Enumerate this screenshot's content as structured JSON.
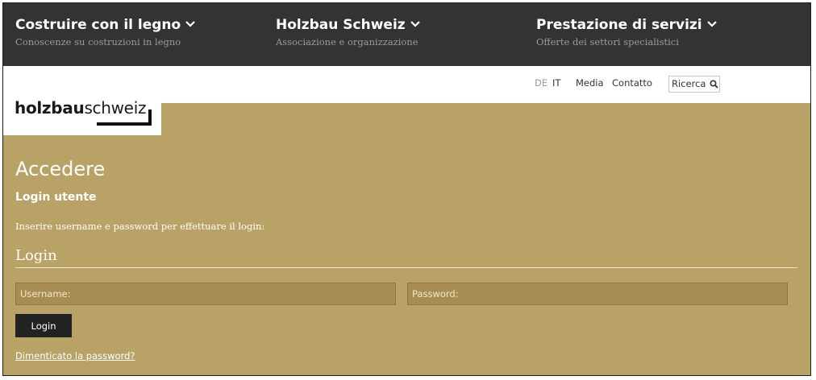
{
  "nav": [
    {
      "title": "Costruire con il legno",
      "subtitle": "Conoscenze su costruzioni in legno",
      "icon": "chevron-down-icon"
    },
    {
      "title": "Holzbau Schweiz",
      "subtitle": "Associazione e organizzazione",
      "icon": "chevron-down-icon"
    },
    {
      "title": "Prestazione di servizi",
      "subtitle": "Offerte dei settori specialistici",
      "icon": "chevron-down-icon"
    }
  ],
  "logo": {
    "bold": "holzbau",
    "regular": "schweiz"
  },
  "utility": {
    "lang_de": "DE",
    "lang_it": "IT",
    "media": "Media",
    "contact": "Contatto",
    "search_placeholder": "Ricerca",
    "search_icon": "search-icon"
  },
  "content": {
    "heading": "Accedere",
    "subheading": "Login utente",
    "intro": "Inserire username e password per effettuare il login:",
    "section_title": "Login",
    "username_placeholder": "Username:",
    "password_placeholder": "Password:",
    "login_button": "Login",
    "forgot_link": "Dimenticato la password?"
  },
  "colors": {
    "nav_background": "#333333",
    "page_background": "#b9a266",
    "field_background": "#a68d51",
    "button_background": "#222222",
    "language_inactive": "#9b9b9b"
  }
}
